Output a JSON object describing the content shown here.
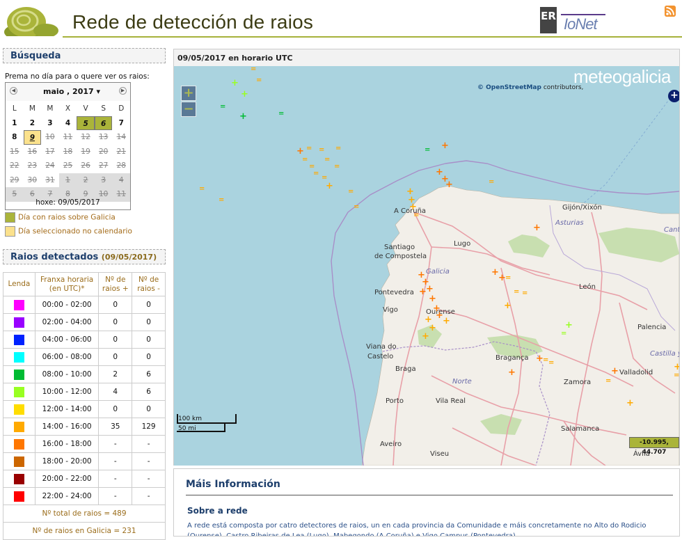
{
  "header": {
    "title": "Rede de detección de raios",
    "er_logo_text": "ER",
    "ionet_logo_text": "IoNet"
  },
  "search": {
    "heading": "Búsqueda",
    "prompt": "Prema no día para o quere ver os raios:",
    "calendar": {
      "month_label": "maio , 2017",
      "weekdays": [
        "L",
        "M",
        "M",
        "X",
        "V",
        "S",
        "D"
      ],
      "weeks": [
        [
          {
            "d": "1",
            "s": ""
          },
          {
            "d": "2",
            "s": ""
          },
          {
            "d": "3",
            "s": ""
          },
          {
            "d": "4",
            "s": ""
          },
          {
            "d": "5",
            "s": "ray"
          },
          {
            "d": "6",
            "s": "ray"
          },
          {
            "d": "7",
            "s": ""
          }
        ],
        [
          {
            "d": "8",
            "s": ""
          },
          {
            "d": "9",
            "s": "sel"
          },
          {
            "d": "10",
            "s": "dis"
          },
          {
            "d": "11",
            "s": "dis"
          },
          {
            "d": "12",
            "s": "dis"
          },
          {
            "d": "13",
            "s": "dis"
          },
          {
            "d": "14",
            "s": "dis"
          }
        ],
        [
          {
            "d": "15",
            "s": "dis"
          },
          {
            "d": "16",
            "s": "dis"
          },
          {
            "d": "17",
            "s": "dis"
          },
          {
            "d": "18",
            "s": "dis"
          },
          {
            "d": "19",
            "s": "dis"
          },
          {
            "d": "20",
            "s": "dis"
          },
          {
            "d": "21",
            "s": "dis"
          }
        ],
        [
          {
            "d": "22",
            "s": "dis"
          },
          {
            "d": "23",
            "s": "dis"
          },
          {
            "d": "24",
            "s": "dis"
          },
          {
            "d": "25",
            "s": "dis"
          },
          {
            "d": "26",
            "s": "dis"
          },
          {
            "d": "27",
            "s": "dis"
          },
          {
            "d": "28",
            "s": "dis"
          }
        ],
        [
          {
            "d": "29",
            "s": "dis"
          },
          {
            "d": "30",
            "s": "dis"
          },
          {
            "d": "31",
            "s": "dis"
          },
          {
            "d": "1",
            "s": "other"
          },
          {
            "d": "2",
            "s": "other"
          },
          {
            "d": "3",
            "s": "other"
          },
          {
            "d": "4",
            "s": "other"
          }
        ],
        [
          {
            "d": "5",
            "s": "other"
          },
          {
            "d": "6",
            "s": "other"
          },
          {
            "d": "7",
            "s": "other"
          },
          {
            "d": "8",
            "s": "other"
          },
          {
            "d": "9",
            "s": "other"
          },
          {
            "d": "10",
            "s": "other"
          },
          {
            "d": "11",
            "s": "other"
          }
        ]
      ],
      "today": "hoxe: 09/05/2017"
    },
    "legend": {
      "ray_day": "Día con raios sobre Galicia",
      "selected_day": "Día seleccionado no calendario",
      "ray_color": "#aab43a",
      "selected_color": "#fbe18c"
    }
  },
  "rays": {
    "heading": "Raios detectados",
    "date": "(09/05/2017)",
    "columns": [
      "Lenda",
      "Franxa horaria (en UTC)*",
      "Nº de raios +",
      "Nº de raios -"
    ],
    "rows": [
      {
        "color": "#ff00ff",
        "range": "00:00 - 02:00",
        "pos": "0",
        "neg": "0"
      },
      {
        "color": "#9900ff",
        "range": "02:00 - 04:00",
        "pos": "0",
        "neg": "0"
      },
      {
        "color": "#0022ff",
        "range": "04:00 - 06:00",
        "pos": "0",
        "neg": "0"
      },
      {
        "color": "#00ffff",
        "range": "06:00 - 08:00",
        "pos": "0",
        "neg": "0"
      },
      {
        "color": "#00bb33",
        "range": "08:00 - 10:00",
        "pos": "2",
        "neg": "6"
      },
      {
        "color": "#99ff22",
        "range": "10:00 - 12:00",
        "pos": "4",
        "neg": "6"
      },
      {
        "color": "#ffdd00",
        "range": "12:00 - 14:00",
        "pos": "0",
        "neg": "0"
      },
      {
        "color": "#ffaa00",
        "range": "14:00 - 16:00",
        "pos": "35",
        "neg": "129"
      },
      {
        "color": "#ff7700",
        "range": "16:00 - 18:00",
        "pos": "-",
        "neg": "-"
      },
      {
        "color": "#cc6600",
        "range": "18:00 - 20:00",
        "pos": "-",
        "neg": "-"
      },
      {
        "color": "#990000",
        "range": "20:00 - 22:00",
        "pos": "-",
        "neg": "-"
      },
      {
        "color": "#ff0000",
        "range": "22:00 - 24:00",
        "pos": "-",
        "neg": "-"
      }
    ],
    "total": "Nº total de raios = 489",
    "galicia": "Nº de raios en Galicia = 231"
  },
  "map": {
    "caption": "09/05/2017 en horario UTC",
    "brand": "meteogalicia",
    "attribution_link": "© OpenStreetMap",
    "attribution_rest": " contributors,",
    "zoom_in": "+",
    "zoom_out": "−",
    "layer_button": "+",
    "scale_km": "100 km",
    "scale_mi": "50 mi",
    "coords": "-10.995, 44.707",
    "places": [
      {
        "n": "A Coruña"
      },
      {
        "n": "Santiago"
      },
      {
        "n": "de Compostela"
      },
      {
        "n": "Lugo"
      },
      {
        "n": "Galicia"
      },
      {
        "n": "Pontevedra"
      },
      {
        "n": "Vigo"
      },
      {
        "n": "Ourense"
      },
      {
        "n": "Viana do"
      },
      {
        "n": "Castelo"
      },
      {
        "n": "Braga"
      },
      {
        "n": "Bragança"
      },
      {
        "n": "Norte"
      },
      {
        "n": "Porto"
      },
      {
        "n": "Vila Real"
      },
      {
        "n": "Aveiro"
      },
      {
        "n": "Viseu"
      },
      {
        "n": "Zamora"
      },
      {
        "n": "Salamanca"
      },
      {
        "n": "Valladolid"
      },
      {
        "n": "Castilla y"
      },
      {
        "n": "Palencia"
      },
      {
        "n": "León"
      },
      {
        "n": "Gijón/Xixón"
      },
      {
        "n": "Asturias"
      },
      {
        "n": "Ávila"
      },
      {
        "n": "Cantabria"
      }
    ]
  },
  "info": {
    "title": "Máis Información",
    "subtitle": "Sobre a rede",
    "text": "A rede está composta por catro detectores de raios, un en cada provincia da Comunidade e máis concretamente no Alto do Rodicio (Ourense), Castro Ribeiras de Lea (Lugo), Mabegondo (A Coruña) e Vigo Campus (Pontevedra)."
  }
}
